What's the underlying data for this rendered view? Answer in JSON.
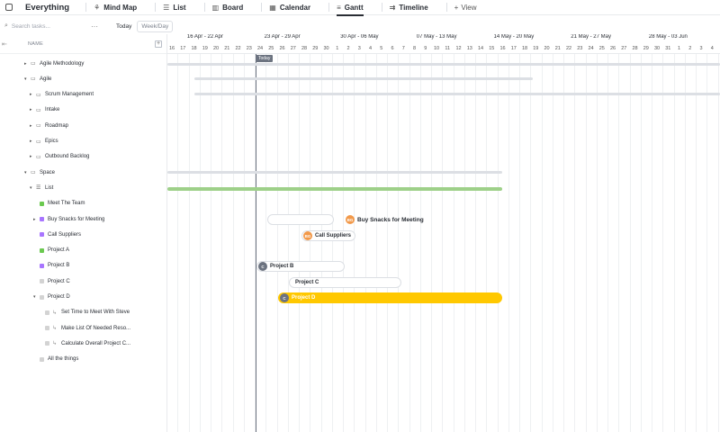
{
  "topnav": {
    "title": "Everything",
    "tabs": [
      {
        "label": "Mind Map",
        "icon": "mindmap-icon"
      },
      {
        "label": "List",
        "icon": "list-icon"
      },
      {
        "label": "Board",
        "icon": "board-icon"
      },
      {
        "label": "Calendar",
        "icon": "calendar-icon"
      },
      {
        "label": "Gantt",
        "icon": "gantt-icon",
        "active": true
      },
      {
        "label": "Timeline",
        "icon": "timeline-icon"
      }
    ],
    "add_view": "View"
  },
  "toolbar": {
    "search_placeholder": "Search tasks...",
    "today": "Today",
    "week_day": "Week/Day"
  },
  "left": {
    "header_name": "NAME",
    "rows": [
      {
        "label": "Agile Methodology",
        "level": 1,
        "kind": "folder"
      },
      {
        "label": "Agile",
        "level": 1,
        "kind": "folder",
        "expanded": true
      },
      {
        "label": "Scrum Management",
        "level": 2,
        "kind": "folder"
      },
      {
        "label": "Intake",
        "level": 2,
        "kind": "folder"
      },
      {
        "label": "Roadmap",
        "level": 2,
        "kind": "folder"
      },
      {
        "label": "Epics",
        "level": 2,
        "kind": "folder"
      },
      {
        "label": "Outbound Backlog",
        "level": 2,
        "kind": "folder"
      },
      {
        "label": "Space",
        "level": 1,
        "kind": "folder",
        "expanded": true
      },
      {
        "label": "List",
        "level": 2,
        "kind": "list",
        "expanded": true
      },
      {
        "label": "Meet The Team",
        "level": 3,
        "kind": "task",
        "color": "#6bc950"
      },
      {
        "label": "Buy Snacks for Meeting",
        "level": 3,
        "kind": "task",
        "color": "#a875ff",
        "arrow": true
      },
      {
        "label": "Call Suppliers",
        "level": 3,
        "kind": "task",
        "color": "#a875ff"
      },
      {
        "label": "Project A",
        "level": 3,
        "kind": "task",
        "color": "#6bc950"
      },
      {
        "label": "Project B",
        "level": 3,
        "kind": "task",
        "color": "#a875ff"
      },
      {
        "label": "Project C",
        "level": 3,
        "kind": "task",
        "color": "#d3d3d3"
      },
      {
        "label": "Project D",
        "level": 3,
        "kind": "task",
        "color": "#d3d3d3",
        "expanded": true
      },
      {
        "label": "Set Time to Meet With Steve",
        "level": 4,
        "kind": "subtask",
        "color": "#d3d3d3"
      },
      {
        "label": "Make List Of Needed Reso...",
        "level": 4,
        "kind": "subtask",
        "color": "#d3d3d3"
      },
      {
        "label": "Calculate Overall Project C...",
        "level": 4,
        "kind": "subtask",
        "color": "#d3d3d3"
      },
      {
        "label": "All the things",
        "level": 3,
        "kind": "task",
        "color": "#d3d3d3"
      }
    ]
  },
  "gantt": {
    "weeks": [
      "16 Apr - 22 Apr",
      "23 Apr - 29 Apr",
      "30 Apr - 06 May",
      "07 May - 13 May",
      "14 May - 20 May",
      "21 May - 27 May",
      "28 May - 03 Jun"
    ],
    "days": [
      "16",
      "17",
      "18",
      "19",
      "20",
      "21",
      "22",
      "23",
      "24",
      "25",
      "26",
      "27",
      "28",
      "29",
      "30",
      "1",
      "2",
      "3",
      "4",
      "5",
      "6",
      "7",
      "8",
      "9",
      "10",
      "11",
      "12",
      "13",
      "14",
      "15",
      "16",
      "17",
      "18",
      "19",
      "20",
      "21",
      "22",
      "23",
      "24",
      "25",
      "26",
      "27",
      "28",
      "29",
      "30",
      "31",
      "1",
      "2",
      "3",
      "4",
      "5"
    ],
    "today_label": "Today",
    "tasks": {
      "buy_snacks": {
        "label": "Buy Snacks for Meeting",
        "avatar": "BG"
      },
      "call_suppliers": {
        "label": "Call Suppliers",
        "avatar": "BG"
      },
      "project_b": {
        "label": "Project B",
        "avatar": "C"
      },
      "project_c": {
        "label": "Project C"
      },
      "project_d": {
        "label": "Project D",
        "avatar": "C"
      }
    }
  }
}
